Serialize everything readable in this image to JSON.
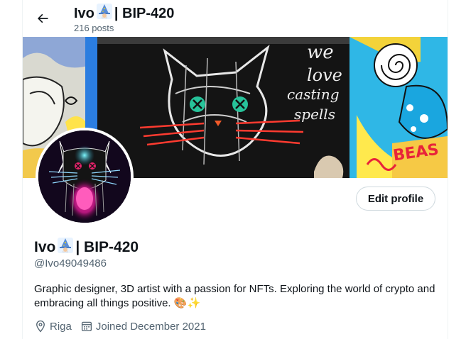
{
  "header": {
    "name_prefix": "Ivo",
    "name_suffix": "| BIP-420",
    "posts": "216 posts",
    "back_icon": "arrow-left-icon"
  },
  "banner": {
    "graffiti_lines": [
      "we",
      "love",
      "casting",
      "spells"
    ]
  },
  "profile": {
    "edit_button": "Edit profile",
    "name_prefix": "Ivo",
    "name_suffix": "| BIP-420",
    "handle": "@Ivo49049486",
    "bio": "Graphic designer, 3D artist with a passion for NFTs. Exploring the world of crypto and embracing all things positive. 🎨✨",
    "location": "Riga",
    "joined": "Joined December 2021"
  },
  "colors": {
    "text": "#0f1419",
    "secondary": "#536471",
    "border": "#cfd9de"
  }
}
